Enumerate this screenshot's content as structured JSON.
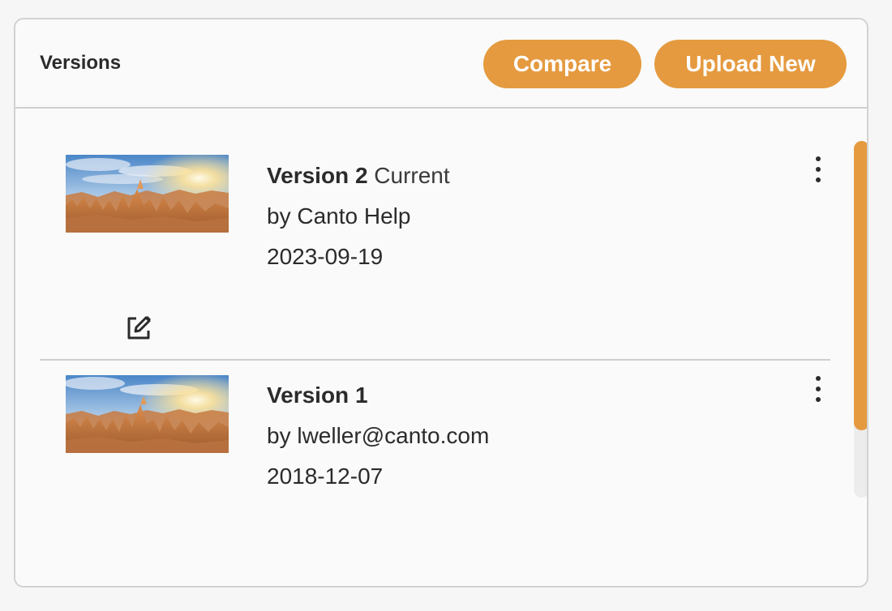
{
  "header": {
    "title": "Versions",
    "compare_label": "Compare",
    "upload_label": "Upload New"
  },
  "versions": [
    {
      "name": "Version 2",
      "tag": "Current",
      "author": "by Canto Help",
      "date": "2023-09-19",
      "thumbnail": "canyon-hoodoos-sunrise",
      "has_edit_icon": true
    },
    {
      "name": "Version 1",
      "tag": "",
      "author": "by lweller@canto.com",
      "date": "2018-12-07",
      "thumbnail": "canyon-hoodoos-sunrise",
      "has_edit_icon": false
    }
  ],
  "icons": {
    "more": "more-vertical-icon",
    "edit": "edit-icon"
  },
  "scroll": {
    "position_fraction": 0.0,
    "visible_fraction": 0.81
  },
  "colors": {
    "accent": "#e59a3f",
    "text": "#2b2b2b",
    "border": "#d2d2d2",
    "panel_bg": "#fafafa"
  }
}
